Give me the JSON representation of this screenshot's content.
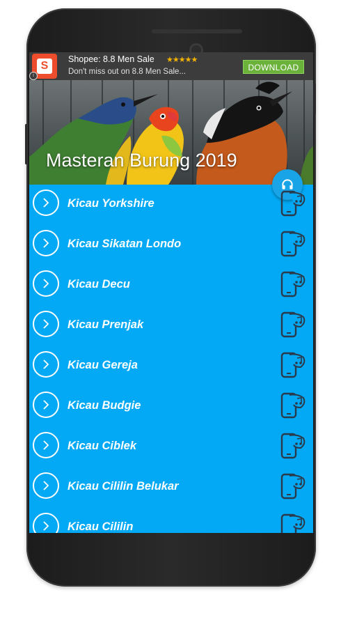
{
  "ad": {
    "title": "Shopee: 8.8 Men Sale",
    "rating_stars": "★★★★★",
    "subtitle": "Don't miss out on 8.8 Men Sale...",
    "button_label": "DOWNLOAD",
    "logo_letter": "S"
  },
  "header": {
    "title": "Masteran Burung 2019"
  },
  "list": {
    "items": [
      {
        "label": "Kicau Yorkshire"
      },
      {
        "label": "Kicau Sikatan Londo"
      },
      {
        "label": "Kicau Decu"
      },
      {
        "label": "Kicau Prenjak"
      },
      {
        "label": "Kicau Gereja"
      },
      {
        "label": "Kicau Budgie"
      },
      {
        "label": "Kicau Ciblek"
      },
      {
        "label": "Kicau Cililin Belukar"
      },
      {
        "label": "Kicau Cililin"
      }
    ]
  },
  "colors": {
    "list_background": "#03a9f4",
    "ad_background": "#3c3c3c",
    "download_button": "#6bb23a",
    "shopee_brand": "#ee4d2d"
  },
  "icons": {
    "row_play": "chevron-right-icon",
    "row_ringtone": "phone-music-icon",
    "fab": "headphones-icon"
  }
}
